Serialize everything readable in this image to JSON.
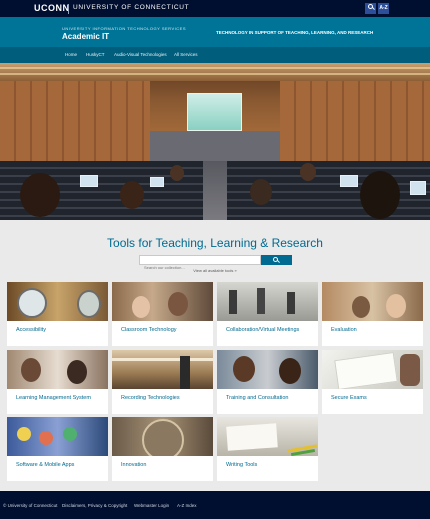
{
  "topbar": {
    "brand": "UCONN",
    "university": "UNIVERSITY OF CONNECTICUT",
    "az_label": "A-Z"
  },
  "header": {
    "department": "UNIVERSITY INFORMATION TECHNOLOGY SERVICES",
    "site_title": "Academic IT",
    "tagline": "TECHNOLOGY IN SUPPORT OF TEACHING, LEARNING, AND RESEARCH"
  },
  "nav": {
    "items": [
      "Home",
      "HuskyCT",
      "Audio-Visual Technologies",
      "All Services"
    ]
  },
  "main": {
    "title": "Tools for Teaching, Learning & Research",
    "search_placeholder": "Search our collection...",
    "all_link": "View all available tools »"
  },
  "cards": [
    "Accessibility",
    "Classroom Technology",
    "Collaboration/Virtual Meetings",
    "Evaluation",
    "Learning Management System",
    "Recording Technologies",
    "Training and Consultation",
    "Secure Exams",
    "Software & Mobile Apps",
    "Innovation",
    "Writing Tools"
  ],
  "footer": {
    "items": [
      "© University of Connecticut",
      "Disclaimers, Privacy & Copyright",
      "Webmaster Login",
      "A-Z Index"
    ]
  },
  "colors": {
    "navy": "#000e2f",
    "teal": "#007497",
    "link_blue": "#006a91"
  }
}
